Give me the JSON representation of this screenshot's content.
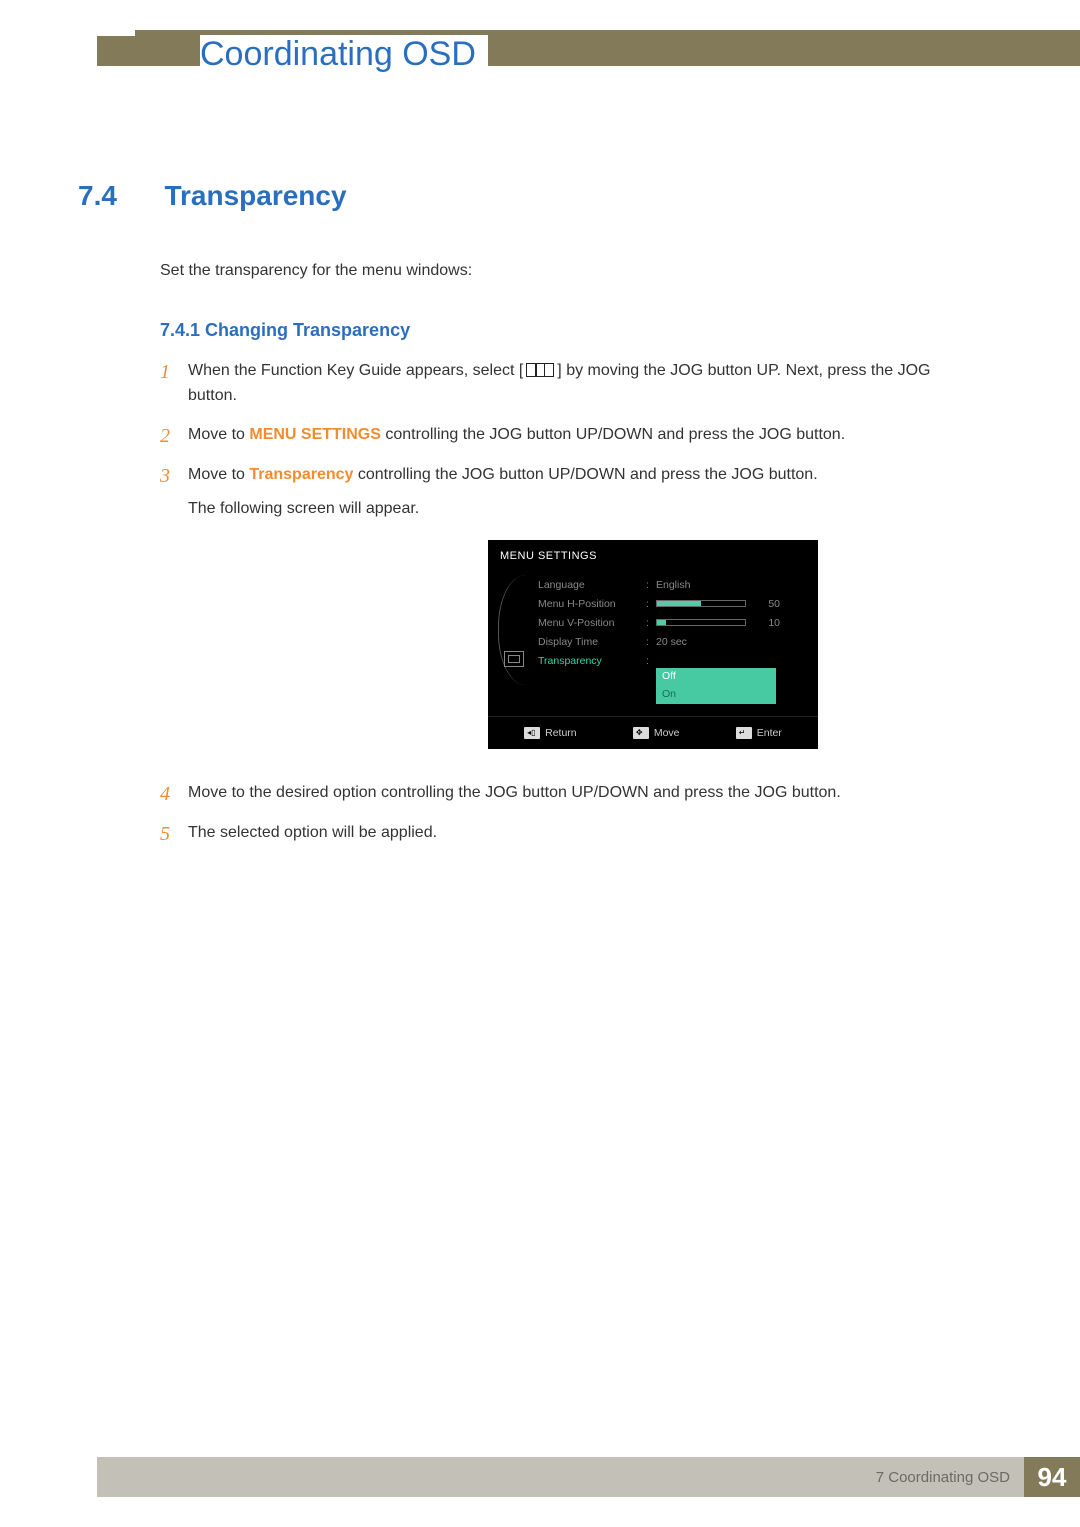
{
  "chapter_title": "Coordinating OSD",
  "section": {
    "num": "7.4",
    "title": "Transparency"
  },
  "intro": "Set the transparency for the menu windows:",
  "subsection": "7.4.1   Changing Transparency",
  "steps": {
    "s1a": "When the Function Key Guide appears, select  [",
    "s1b": "]  by moving the JOG button UP. Next, press the JOG button.",
    "s2a": "Move to ",
    "s2b": "MENU SETTINGS",
    "s2c": " controlling the JOG button UP/DOWN and press the JOG button.",
    "s3a": "Move to ",
    "s3b": "Transparency",
    "s3c": " controlling the JOG button UP/DOWN and press the JOG button.",
    "s3d": "The following screen will appear.",
    "s4": "Move to the desired option controlling the JOG button UP/DOWN and press the JOG button.",
    "s5": "The selected option will be applied."
  },
  "nums": {
    "n1": "1",
    "n2": "2",
    "n3": "3",
    "n4": "4",
    "n5": "5"
  },
  "osd": {
    "header": "MENU SETTINGS",
    "rows": {
      "language": {
        "label": "Language",
        "value": "English"
      },
      "hpos": {
        "label": "Menu H-Position",
        "value": "50",
        "pct": 50
      },
      "vpos": {
        "label": "Menu V-Position",
        "value": "10",
        "pct": 10
      },
      "dtime": {
        "label": "Display Time",
        "value": "20 sec"
      },
      "transparency": {
        "label": "Transparency",
        "opt_off": "Off",
        "opt_on": "On"
      }
    },
    "footer": {
      "return": "Return",
      "move": "Move",
      "enter": "Enter"
    }
  },
  "footer": {
    "text": "7  Coordinating OSD",
    "page": "94"
  }
}
